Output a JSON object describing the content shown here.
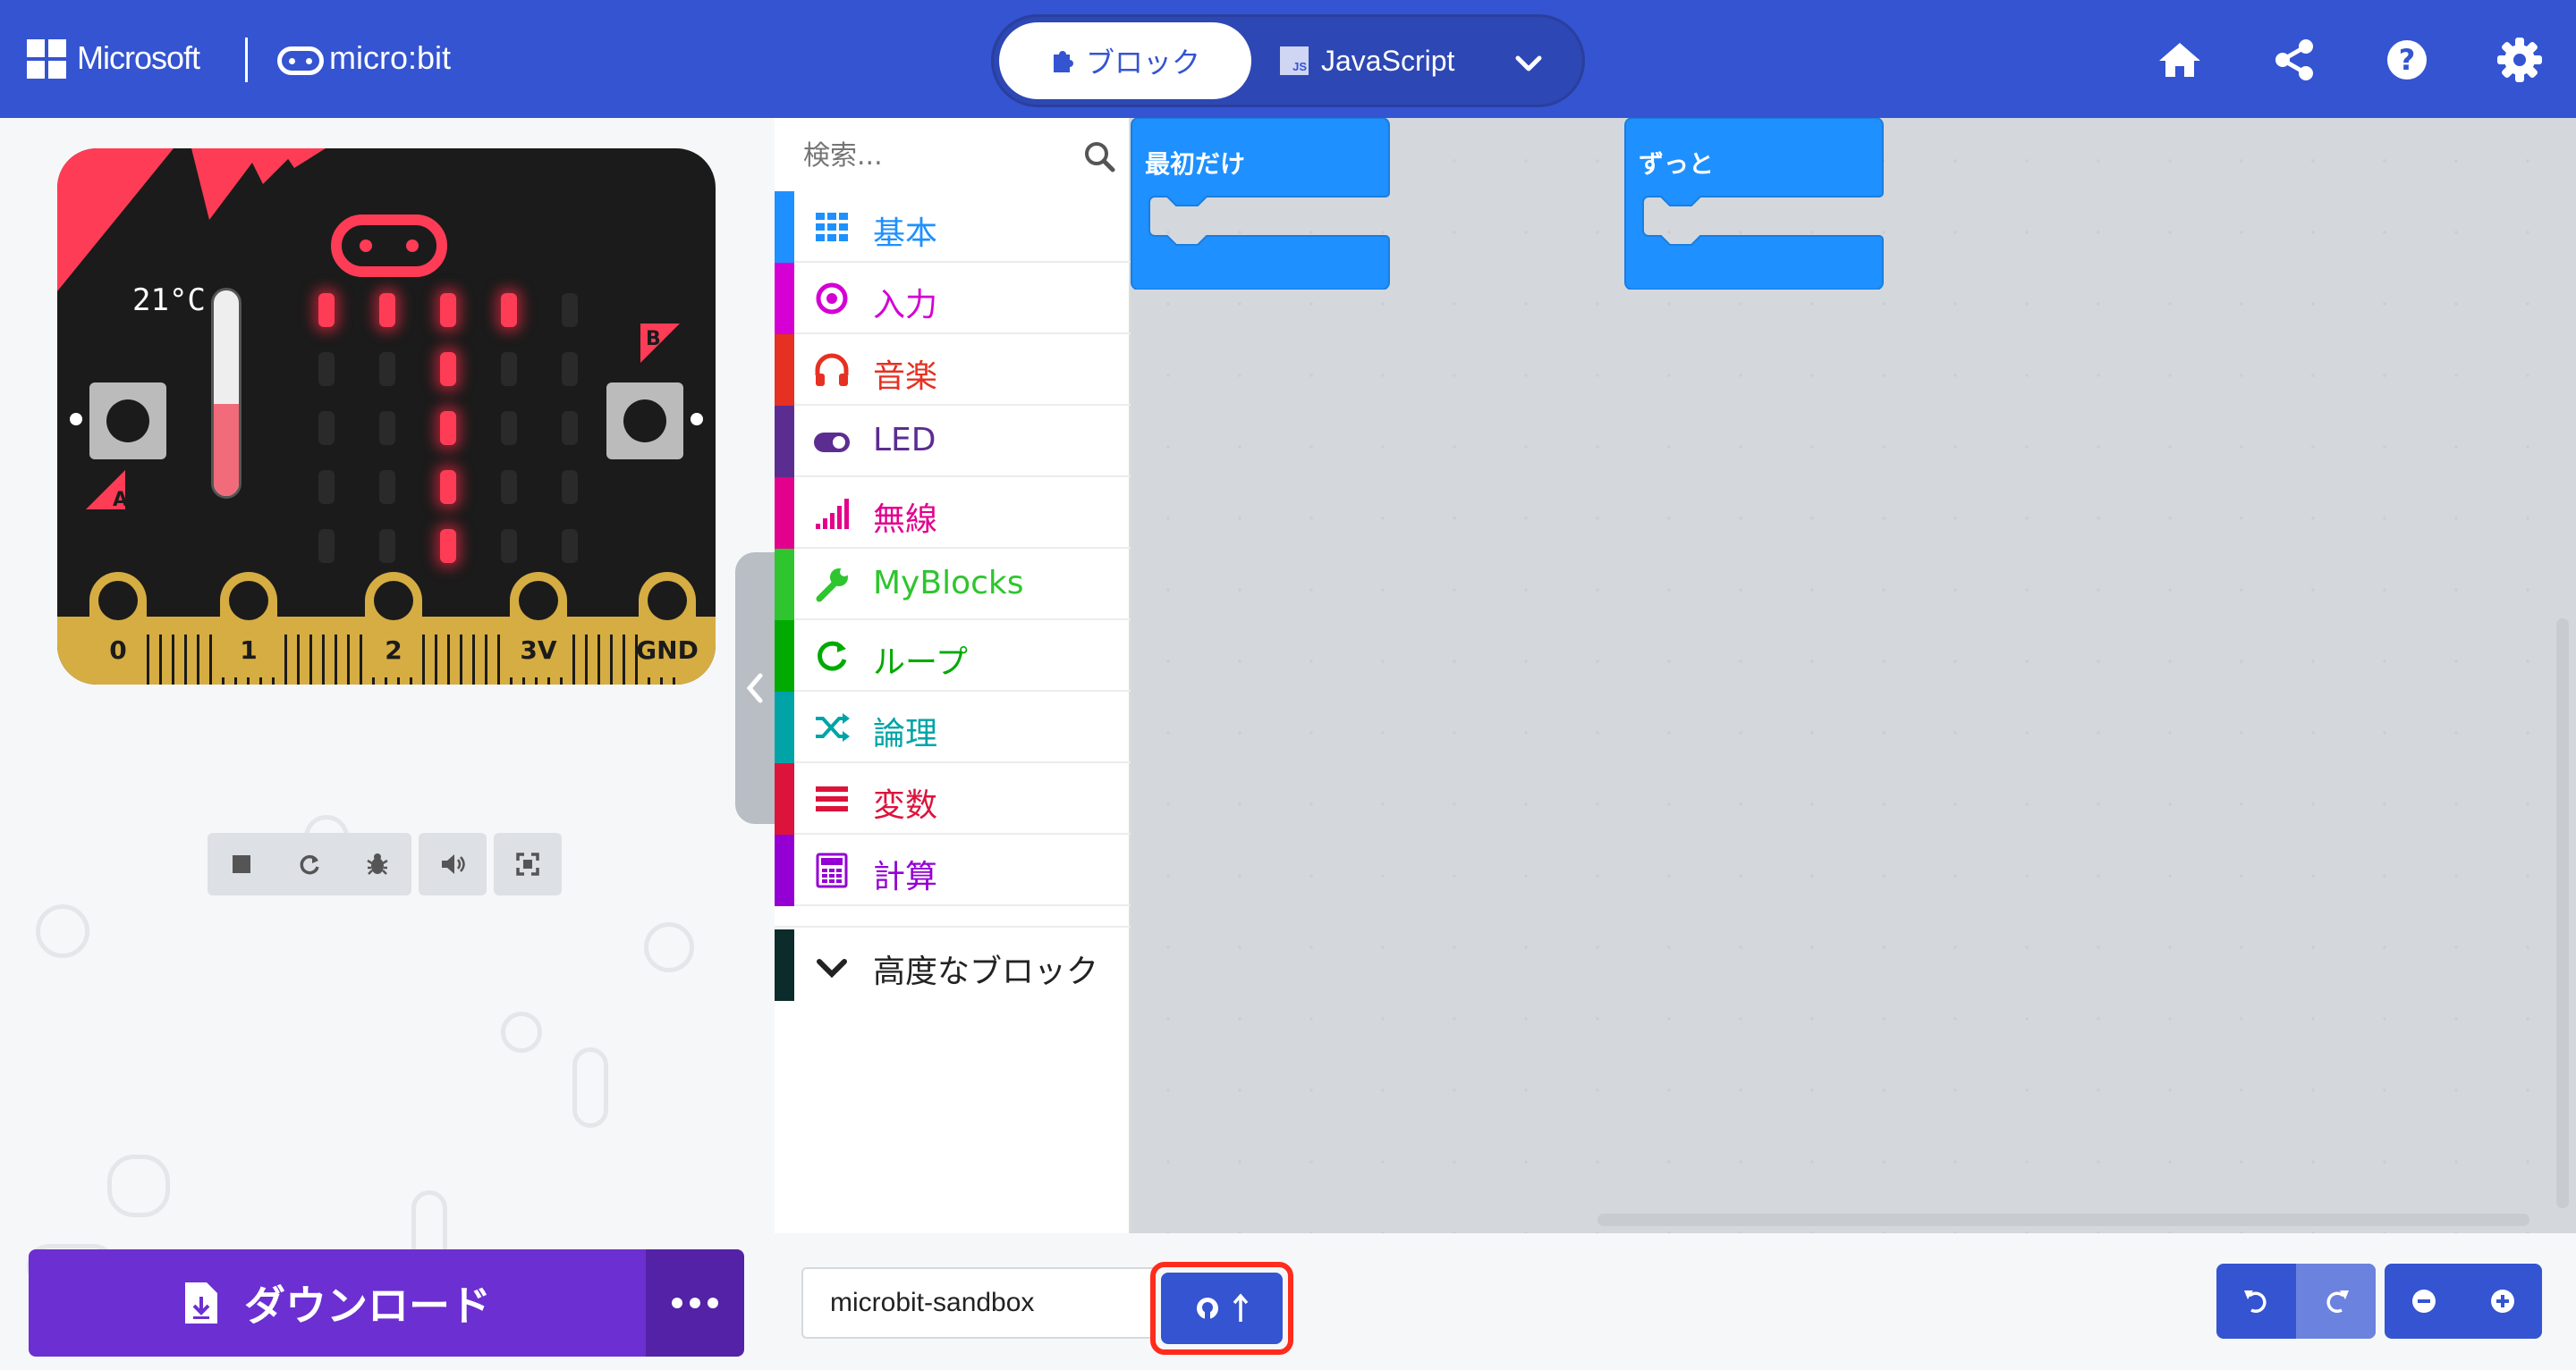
{
  "header": {
    "brand_microsoft": "Microsoft",
    "brand_microbit": "micro:bit",
    "tab_blocks": "ブロック",
    "tab_javascript": "JavaScript",
    "js_badge": "JS",
    "icons": [
      "home-icon",
      "share-icon",
      "help-icon",
      "settings-icon"
    ]
  },
  "simulator": {
    "temperature": "21°C",
    "temperature_level": 0.45,
    "pins": [
      "0",
      "1",
      "2",
      "3V",
      "GND"
    ],
    "button_a": "A",
    "button_b": "B",
    "led_matrix": [
      [
        1,
        1,
        1,
        1,
        0
      ],
      [
        0,
        0,
        1,
        0,
        0
      ],
      [
        0,
        0,
        1,
        0,
        0
      ],
      [
        0,
        0,
        1,
        0,
        0
      ],
      [
        0,
        0,
        1,
        0,
        0
      ]
    ],
    "toolbar_icons": [
      "stop-icon",
      "restart-icon",
      "debug-icon",
      "sound-icon",
      "fullscreen-icon"
    ]
  },
  "toolbox": {
    "search_placeholder": "検索...",
    "categories": [
      {
        "label": "基本",
        "color": "#1e90ff",
        "icon": "grid-icon"
      },
      {
        "label": "入力",
        "color": "#d400d4",
        "icon": "target-icon"
      },
      {
        "label": "音楽",
        "color": "#e63022",
        "icon": "headphones-icon"
      },
      {
        "label": "LED",
        "color": "#5c2d91",
        "icon": "toggle-icon"
      },
      {
        "label": "無線",
        "color": "#e3008c",
        "icon": "signal-icon"
      },
      {
        "label": "MyBlocks",
        "color": "#2ec52e",
        "icon": "wrench-icon"
      },
      {
        "label": "ループ",
        "color": "#00aa00",
        "icon": "loop-icon"
      },
      {
        "label": "論理",
        "color": "#00a4a6",
        "icon": "shuffle-icon"
      },
      {
        "label": "変数",
        "color": "#dc143c",
        "icon": "list-icon"
      },
      {
        "label": "計算",
        "color": "#9400d3",
        "icon": "calculator-icon"
      }
    ],
    "advanced_label": "高度なブロック"
  },
  "workspace": {
    "blocks": [
      {
        "label": "最初だけ",
        "color": "#1e90ff"
      },
      {
        "label": "ずっと",
        "color": "#1e90ff"
      }
    ]
  },
  "footer": {
    "download_label": "ダウンロード",
    "project_name": "microbit-sandbox"
  },
  "colors": {
    "header": "#3454d1",
    "download": "#6c2fd2",
    "highlight": "#ff2b1c"
  }
}
